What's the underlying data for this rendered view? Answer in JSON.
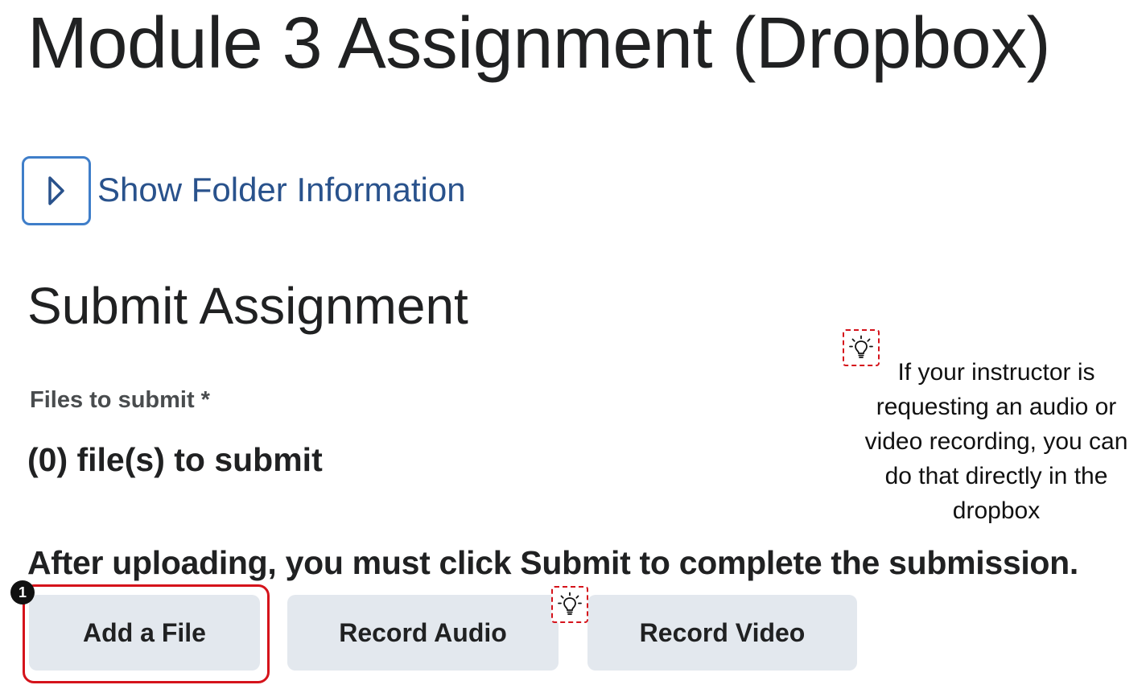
{
  "page": {
    "title": "Module 3 Assignment (Dropbox)"
  },
  "folder_info": {
    "link_label": "Show Folder Information"
  },
  "submit": {
    "heading": "Submit Assignment",
    "files_label": "Files to submit *",
    "files_count": "(0) file(s) to submit",
    "instruction": "After uploading, you must click Submit to complete the submission."
  },
  "actions": {
    "add_file_label": "Add a File",
    "record_audio_label": "Record Audio",
    "record_video_label": "Record Video"
  },
  "annotations": {
    "step_number": "1",
    "tip_text": "If your instructor is requesting an audio or video recording, you can do that directly in the dropbox",
    "highlight_color": "#d5131b"
  },
  "colors": {
    "link": "#29528c",
    "focus_ring": "#3f7ec9",
    "button_bg": "#e3e8ee",
    "text": "#202122"
  },
  "icons": {
    "folder_toggle": "chevron-right-icon",
    "tip": "lightbulb-icon"
  }
}
